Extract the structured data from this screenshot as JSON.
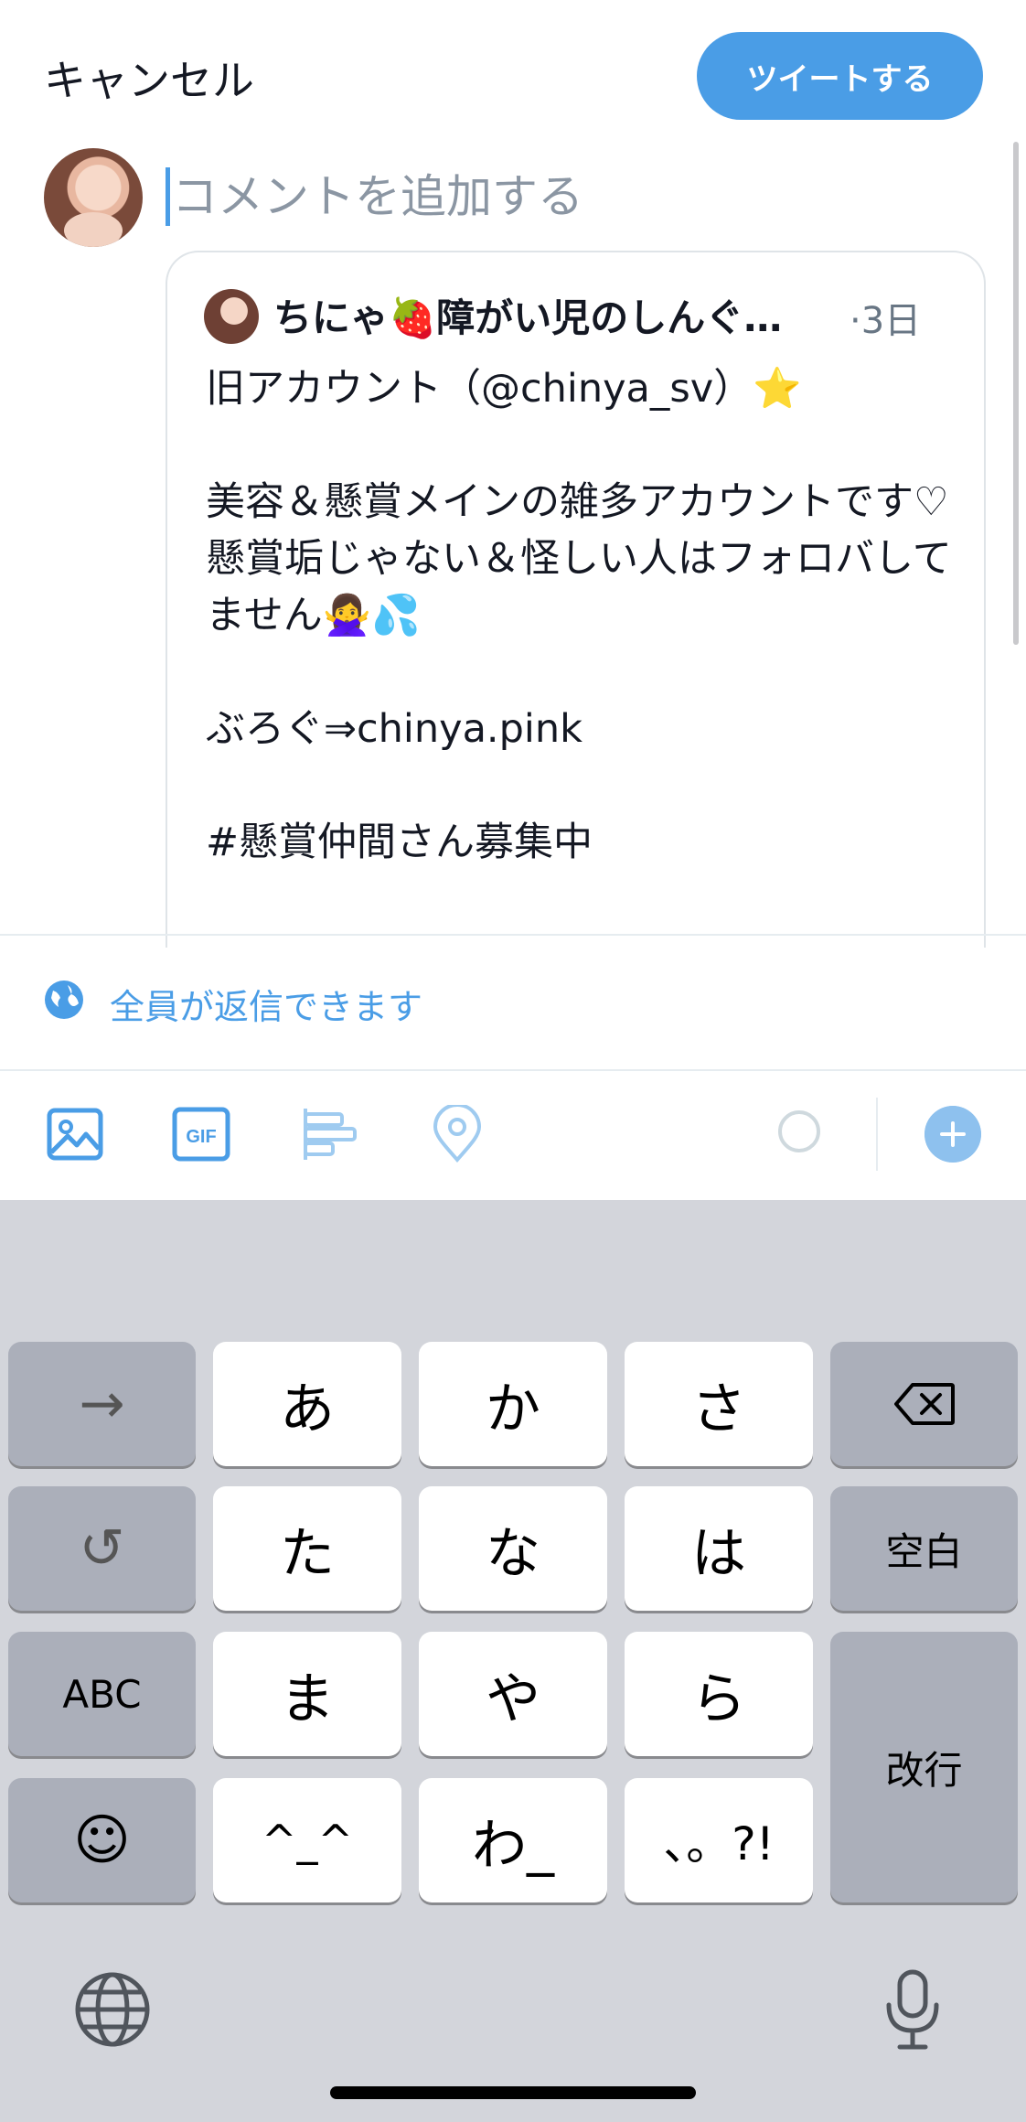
{
  "header": {
    "cancel_label": "キャンセル",
    "tweet_button_label": "ツイートする"
  },
  "composer": {
    "placeholder": "コメントを追加する"
  },
  "quoted_tweet": {
    "author_name": "ちにゃ🍓障がい児のしんぐ…",
    "time": "·3日",
    "body": "旧アカウント（@chinya_sv）⭐\n\n美容＆懸賞メインの雑多アカウントです♡\n懸賞垢じゃない＆怪しい人はフォロバしてません🙅‍♀️💦\n\nぶろぐ⇒chinya.pink\n\n#懸賞仲間さん募集中"
  },
  "reply_setting": {
    "label": "全員が返信できます"
  },
  "toolbar": {
    "gif_label": "GIF",
    "icons": [
      "image-icon",
      "gif-icon",
      "poll-icon",
      "location-icon",
      "character-counter",
      "add-thread-icon"
    ]
  },
  "keyboard": {
    "row1": [
      "→",
      "あ",
      "か",
      "さ",
      "⌫"
    ],
    "row2": [
      "↺",
      "た",
      "な",
      "は",
      "空白"
    ],
    "row3": [
      "ABC",
      "ま",
      "や",
      "ら",
      "改行"
    ],
    "row4": [
      "☺",
      "^_^",
      "わ_",
      "、。?!"
    ]
  },
  "colors": {
    "accent": "#4a9de6",
    "accent_light": "#8ec1ee",
    "keyboard_bg": "#d3d5db",
    "key_gray": "#abafba"
  }
}
